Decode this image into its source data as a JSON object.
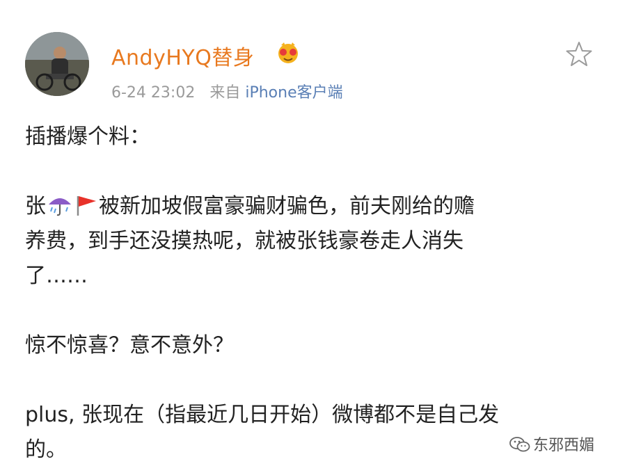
{
  "post": {
    "username": "AndyHYQ替身",
    "time": "6-24 23:02",
    "source_prefix": "来自",
    "source_device": "iPhone客户端",
    "lines": {
      "line1": "插播爆个料：",
      "line2a": "张",
      "line2b": "被新加坡假富豪骗财骗色，前夫刚给的赡",
      "line3": "养费，到手还没摸热呢，就被张钱豪卷走人消失",
      "line4": "了……",
      "line5": "惊不惊喜？意不意外？",
      "line6": "plus, 张现在（指最近几日开始）微博都不是自己发",
      "line7": "的。"
    },
    "emojis": [
      "umbrella-rain-icon",
      "red-flag-icon"
    ]
  },
  "watermark": {
    "text": "东邪西媚"
  },
  "colors": {
    "username": "#e8791f",
    "meta": "#9a9a9a",
    "device": "#5a7fb5",
    "text": "#222222"
  }
}
